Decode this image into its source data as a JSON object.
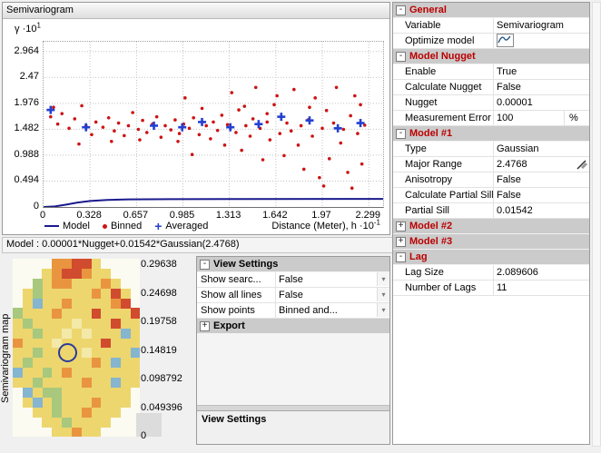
{
  "semivariogram_panel": {
    "title": "Semivariogram",
    "y_axis_symbol": "γ",
    "y_axis_multiplier_base": "·10",
    "y_axis_multiplier_exp": "1",
    "x_axis_label": "Distance (Meter), h",
    "x_axis_multiplier_base": "·10",
    "x_axis_multiplier_exp": "-1",
    "legend": {
      "model": "Model",
      "binned": "Binned",
      "averaged": "Averaged"
    },
    "model_formula": "Model : 0.00001*Nugget+0.01542*Gaussian(2.4768)"
  },
  "chart_data": {
    "type": "scatter",
    "xlim": [
      0,
      2.4
    ],
    "ylim": [
      0,
      3.15
    ],
    "x_ticks": [
      0,
      0.328,
      0.657,
      0.985,
      1.313,
      1.642,
      1.97,
      2.299
    ],
    "y_ticks": [
      0,
      0.494,
      0.988,
      1.482,
      1.976,
      2.47,
      2.964
    ],
    "series": [
      {
        "name": "Model",
        "type": "line",
        "color": "#1a1a8e",
        "points": [
          [
            0,
            0
          ],
          [
            0.08,
            0.01
          ],
          [
            0.16,
            0.045
          ],
          [
            0.24,
            0.085
          ],
          [
            0.33,
            0.115
          ],
          [
            0.45,
            0.135
          ],
          [
            0.6,
            0.145
          ],
          [
            0.9,
            0.15
          ],
          [
            1.4,
            0.152
          ],
          [
            2.4,
            0.153
          ]
        ]
      },
      {
        "name": "Binned",
        "type": "dot",
        "color": "#cc1414",
        "points": [
          [
            0.05,
            1.72
          ],
          [
            0.07,
            1.9
          ],
          [
            0.1,
            1.58
          ],
          [
            0.13,
            1.78
          ],
          [
            0.18,
            1.5
          ],
          [
            0.22,
            1.68
          ],
          [
            0.25,
            1.2
          ],
          [
            0.27,
            1.93
          ],
          [
            0.3,
            1.55
          ],
          [
            0.34,
            1.38
          ],
          [
            0.37,
            1.62
          ],
          [
            0.42,
            1.52
          ],
          [
            0.46,
            1.7
          ],
          [
            0.48,
            1.25
          ],
          [
            0.5,
            1.45
          ],
          [
            0.53,
            1.6
          ],
          [
            0.57,
            1.36
          ],
          [
            0.6,
            1.55
          ],
          [
            0.63,
            1.8
          ],
          [
            0.67,
            1.48
          ],
          [
            0.68,
            1.28
          ],
          [
            0.7,
            1.65
          ],
          [
            0.73,
            1.42
          ],
          [
            0.77,
            1.58
          ],
          [
            0.8,
            1.72
          ],
          [
            0.83,
            1.33
          ],
          [
            0.86,
            1.55
          ],
          [
            0.9,
            1.47
          ],
          [
            0.93,
            1.66
          ],
          [
            0.95,
            1.25
          ],
          [
            0.96,
            1.4
          ],
          [
            0.99,
            1.58
          ],
          [
            1.0,
            2.08
          ],
          [
            1.03,
            1.5
          ],
          [
            1.05,
            1.0
          ],
          [
            1.06,
            1.7
          ],
          [
            1.1,
            1.38
          ],
          [
            1.12,
            1.88
          ],
          [
            1.15,
            1.55
          ],
          [
            1.18,
            1.3
          ],
          [
            1.2,
            1.62
          ],
          [
            1.23,
            1.46
          ],
          [
            1.26,
            1.75
          ],
          [
            1.28,
            1.18
          ],
          [
            1.3,
            1.57
          ],
          [
            1.33,
            2.18
          ],
          [
            1.36,
            1.42
          ],
          [
            1.38,
            1.85
          ],
          [
            1.4,
            1.08
          ],
          [
            1.42,
            1.92
          ],
          [
            1.43,
            1.55
          ],
          [
            1.46,
            1.35
          ],
          [
            1.48,
            1.68
          ],
          [
            1.5,
            2.28
          ],
          [
            1.53,
            1.5
          ],
          [
            1.55,
            0.9
          ],
          [
            1.58,
            1.78
          ],
          [
            1.6,
            1.28
          ],
          [
            1.63,
            1.95
          ],
          [
            1.65,
            2.12
          ],
          [
            1.67,
            1.4
          ],
          [
            1.7,
            0.98
          ],
          [
            1.72,
            1.6
          ],
          [
            1.75,
            1.45
          ],
          [
            1.77,
            2.24
          ],
          [
            1.8,
            1.18
          ],
          [
            1.82,
            1.55
          ],
          [
            1.84,
            0.72
          ],
          [
            1.87,
            1.66
          ],
          [
            1.9,
            1.35
          ],
          [
            1.92,
            2.08
          ],
          [
            1.95,
            0.56
          ],
          [
            1.97,
            1.5
          ],
          [
            1.98,
            0.4
          ],
          [
            2.0,
            1.84
          ],
          [
            2.02,
            0.92
          ],
          [
            2.05,
            1.6
          ],
          [
            2.07,
            2.28
          ],
          [
            2.1,
            1.22
          ],
          [
            2.12,
            1.48
          ],
          [
            2.15,
            0.66
          ],
          [
            2.17,
            1.74
          ],
          [
            2.18,
            0.36
          ],
          [
            2.2,
            2.12
          ],
          [
            2.22,
            1.4
          ],
          [
            2.24,
            1.95
          ],
          [
            2.25,
            0.82
          ],
          [
            2.27,
            1.56
          ],
          [
            1.88,
            1.9
          ],
          [
            1.58,
            1.62
          ]
        ]
      },
      {
        "name": "Averaged",
        "type": "cross",
        "color": "#2340d0",
        "points": [
          [
            0.05,
            1.85
          ],
          [
            0.3,
            1.52
          ],
          [
            0.78,
            1.55
          ],
          [
            0.98,
            1.52
          ],
          [
            1.12,
            1.62
          ],
          [
            1.32,
            1.52
          ],
          [
            1.52,
            1.58
          ],
          [
            1.68,
            1.72
          ],
          [
            1.88,
            1.65
          ],
          [
            2.08,
            1.5
          ],
          [
            2.24,
            1.6
          ]
        ]
      }
    ]
  },
  "map_panel": {
    "side_label": "Semivariogram map",
    "scale_values": [
      "0.29638",
      "0.24698",
      "0.19758",
      "0.14819",
      "0.098792",
      "0.049396",
      "0"
    ],
    "palette": {
      "Y": "#edd66e",
      "L": "#f3e9a8",
      "O": "#e9953f",
      "R": "#d14b2e",
      "G": "#a8c87d",
      "B": "#85b5cf"
    },
    "grid": [
      "....OORRY....",
      "...YORROYY...",
      "..GYOOYYYOY..",
      ".YGYYYYYOYRY.",
      ".YBYYOYYYYOR.",
      "GYYYOYYYRYYYR",
      "YGYYYYLYYYRYY",
      "YYGYYLYLYYYBY",
      "OYYYLYYYYRYYY",
      "YYGYYYYLYYYYB",
      "YGYYYYYYOYBYY",
      "BYYGYOYYYYYYY",
      "YYGYYYYOYYBYY",
      ".BYGGYYYYYYY.",
      ".YBYGYYYOYYY.",
      "..YYGYYOYYY..",
      "...YYGYYYY...",
      "....YYOYY...."
    ]
  },
  "view_settings_panel": {
    "sections": [
      {
        "label": "View Settings",
        "expanded": true,
        "rows": [
          {
            "name": "Show searc...",
            "value": "False",
            "dropdown": true
          },
          {
            "name": "Show all lines",
            "value": "False",
            "dropdown": true
          },
          {
            "name": "Show points",
            "value": "Binned and...",
            "dropdown": true
          }
        ]
      },
      {
        "label": "Export",
        "expanded": false,
        "rows": []
      }
    ],
    "footer_label": "View Settings"
  },
  "properties_panel": {
    "sections": [
      {
        "label": "General",
        "expanded": true,
        "rows": [
          {
            "name": "Variable",
            "value": "Semivariogram"
          },
          {
            "name": "Optimize model",
            "value": "",
            "icon": "optimize-model-icon"
          }
        ]
      },
      {
        "label": "Model Nugget",
        "expanded": true,
        "rows": [
          {
            "name": "Enable",
            "value": "True"
          },
          {
            "name": "Calculate Nugget",
            "value": "False"
          },
          {
            "name": "Nugget",
            "value": "0.00001"
          },
          {
            "name": "Measurement Error",
            "value": "100",
            "suffix": "%"
          }
        ]
      },
      {
        "label": "Model #1",
        "expanded": true,
        "rows": [
          {
            "name": "Type",
            "value": "Gaussian"
          },
          {
            "name": "Major Range",
            "value": "2.4768",
            "icon": "slider-icon"
          },
          {
            "name": "Anisotropy",
            "value": "False"
          },
          {
            "name": "Calculate Partial Sill",
            "value": "False"
          },
          {
            "name": "Partial Sill",
            "value": "0.01542"
          }
        ]
      },
      {
        "label": "Model #2",
        "expanded": false,
        "rows": []
      },
      {
        "label": "Model #3",
        "expanded": false,
        "rows": []
      },
      {
        "label": "Lag",
        "expanded": true,
        "rows": [
          {
            "name": "Lag Size",
            "value": "2.089606"
          },
          {
            "name": "Number of Lags",
            "value": "11"
          }
        ]
      }
    ]
  }
}
